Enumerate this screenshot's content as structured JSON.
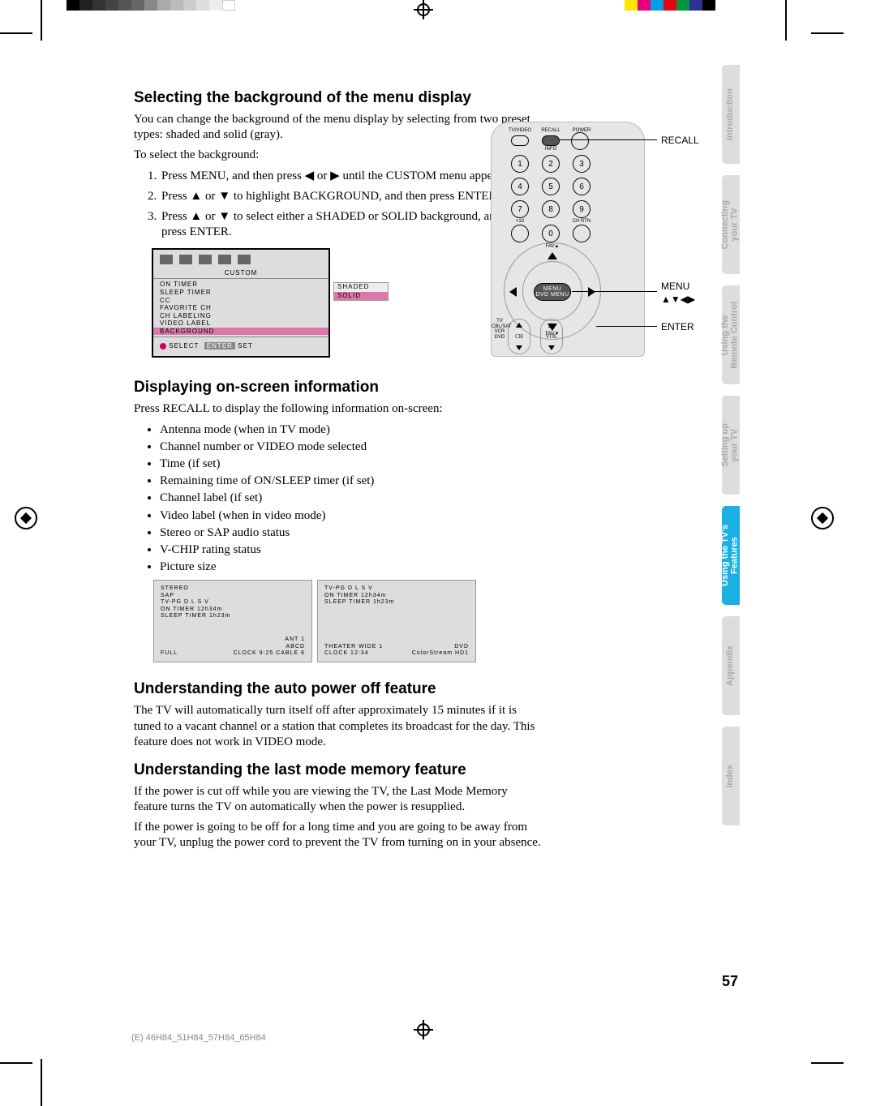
{
  "tabs": [
    "Introduction",
    "Connecting\nyour TV",
    "Using the\nRemote Control",
    "Setting up\nyour TV",
    "Using the TV's\nFeatures",
    "Appendix",
    "Index"
  ],
  "active_tab_index": 4,
  "page_number": "57",
  "footer_code": "(E) 46H84_51H84_57H84_65H84",
  "remote_callouts": {
    "recall": "RECALL",
    "menu": "MENU",
    "arrows": "▲▼◀▶",
    "enter": "ENTER"
  },
  "remote_labels": {
    "tvvideo": "TV/VIDEO",
    "recall": "RECALL",
    "info": "INFO",
    "power": "POWER",
    "plus10": "+10",
    "chrtn": "CH RTN",
    "fav_up": "FAV▲",
    "fav_dn": "FAV▼",
    "menu": "MENU\nDVD MENU",
    "ch": "CH",
    "vol": "VOL",
    "side": "TV\nCBL/SAT\nVCR\nDVD"
  },
  "section1": {
    "heading": "Selecting the background of the menu display",
    "p1": "You can change the background of the menu display by selecting from two preset types: shaded and solid (gray).",
    "p2": "To select the background:",
    "steps": [
      "Press MENU, and then press ◀ or ▶ until the CUSTOM menu appears.",
      "Press ▲ or ▼ to highlight BACKGROUND, and then press ENTER.",
      "Press ▲ or ▼ to select either a SHADED or SOLID background, and then press ENTER."
    ],
    "osd": {
      "title": "CUSTOM",
      "rows": [
        "ON TIMER",
        "SLEEP TIMER",
        "CC",
        "FAVORITE CH",
        "CH LABELING",
        "VIDEO LABEL",
        "BACKGROUND"
      ],
      "selected_index": 6,
      "side": [
        "SHADED",
        "SOLID"
      ],
      "side_selected_index": 1,
      "footer_select": "SELECT",
      "footer_enter": "ENTER",
      "footer_set": "SET"
    }
  },
  "section2": {
    "heading": "Displaying on-screen information",
    "p1": "Press RECALL to display the following information on-screen:",
    "bullets": [
      "Antenna mode (when in TV mode)",
      "Channel number or VIDEO mode selected",
      "Time (if set)",
      "Remaining time of ON/SLEEP timer (if set)",
      "Channel label (if set)",
      "Video label (when in video mode)",
      "Stereo or SAP audio status",
      "V-CHIP rating status",
      "Picture size"
    ],
    "screens": [
      {
        "tl": "STEREO\nSAP\nTV-PG D L S V\nON TIMER  12h34m\nSLEEP TIMER  1h23m",
        "bl": "FULL",
        "br": "ANT 1\nABCD\nCLOCK  9:25  CABLE  6"
      },
      {
        "tl": "TV-PG D L S V\nON TIMER  12h34m\nSLEEP TIMER  1h23m",
        "bl": "THEATER WIDE 1\nCLOCK  12:34",
        "br": "DVD\nColorStream HD1"
      }
    ]
  },
  "section3": {
    "heading": "Understanding the auto power off feature",
    "p1": "The TV will automatically turn itself off after approximately 15 minutes if it is tuned to a vacant channel or a station that completes its broadcast for the day. This feature does not work in VIDEO mode."
  },
  "section4": {
    "heading": "Understanding the last mode memory feature",
    "p1": "If the power is cut off while you are viewing the TV, the Last Mode Memory feature turns the TV on automatically when the power is resupplied.",
    "p2": "If the power is going to be off for a long time and you are going to be away from your TV, unplug the power cord to prevent the TV from turning on in your absence."
  }
}
